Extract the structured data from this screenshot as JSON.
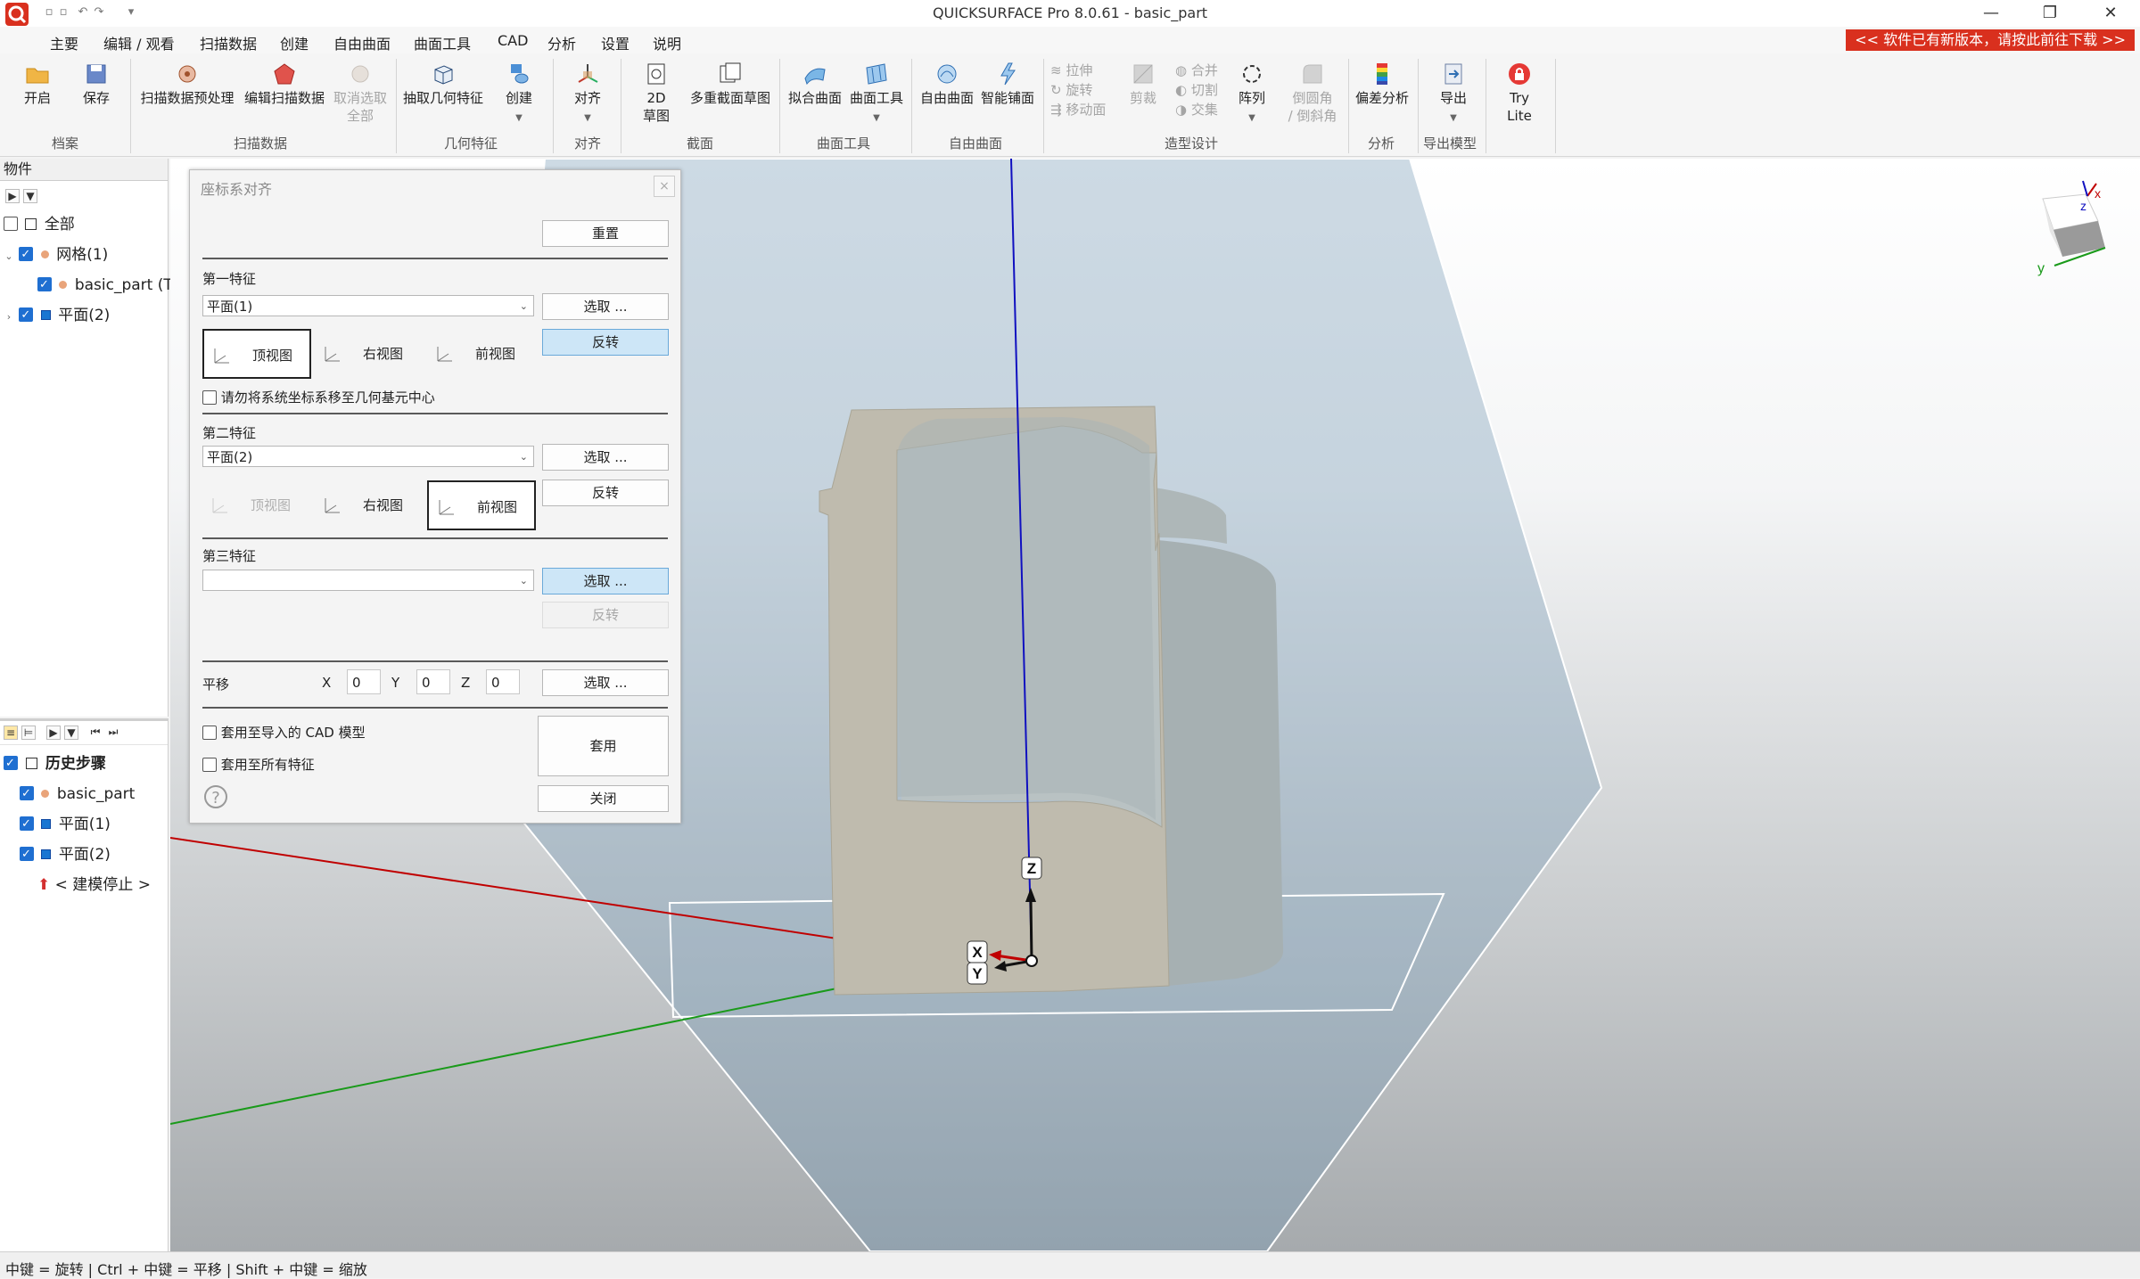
{
  "window": {
    "title": "QUICKSURFACE Pro 8.0.61 - basic_part",
    "minimize": "—",
    "maximize": "❐",
    "close": "✕"
  },
  "menu": {
    "items": [
      "主要",
      "编辑 / 观看",
      "扫描数据",
      "创建",
      "自由曲面",
      "曲面工具",
      "CAD",
      "分析",
      "设置",
      "说明"
    ],
    "active": "主要",
    "update_banner": "<< 软件已有新版本，请按此前往下载 >>"
  },
  "ribbon": {
    "buttons": {
      "open": "开启",
      "save": "保存",
      "scan_preprocess": "扫描数据预处理",
      "edit_scan": "编辑扫描数据",
      "deselect_all": "取消选取全部",
      "extract_features": "抽取几何特征",
      "create": "创建",
      "align": "对齐",
      "sketch2d_line1": "2D",
      "sketch2d_line2": "草图",
      "multi_section": "多重截面草图",
      "fit_surface": "拟合曲面",
      "surface_tools": "曲面工具",
      "freeform": "自由曲面",
      "smart_surface": "智能铺面",
      "extrude": "拉伸",
      "revolve": "旋转",
      "move_face": "移动面",
      "trim": "剪裁",
      "union": "合并",
      "cut": "切割",
      "intersect": "交集",
      "pattern": "阵列",
      "fillet_line1": "倒圆角",
      "fillet_line2": "/ 倒斜角",
      "deviation": "偏差分析",
      "export": "导出",
      "try_lite_line1": "Try",
      "try_lite_line2": "Lite"
    },
    "groups": {
      "file": "档案",
      "scan": "扫描数据",
      "geometry": "几何特征",
      "align": "对齐",
      "section": "截面",
      "surface_tools": "曲面工具",
      "freeform": "自由曲面",
      "modeling": "造型设计",
      "analysis": "分析",
      "export_model": "导出模型"
    }
  },
  "objects_panel": {
    "header": "物件",
    "tree": {
      "all": "全部",
      "mesh": "网格(1)",
      "basic_part": "basic_part (T",
      "plane": "平面(2)"
    }
  },
  "history_panel": {
    "title": "历史步骤",
    "items": [
      "basic_part",
      "平面(1)",
      "平面(2)"
    ],
    "stop": "< 建模停止 >"
  },
  "dialog": {
    "title": "座标系对齐",
    "reset": "重置",
    "feature1": {
      "label": "第一特征",
      "value": "平面(1)",
      "select": "选取 ...",
      "flip": "反转",
      "views": [
        "顶视图",
        "右视图",
        "前视图"
      ],
      "selected_view": "顶视图",
      "no_move_label": "请勿将系统坐标系移至几何基元中心",
      "no_move_checked": false
    },
    "feature2": {
      "label": "第二特征",
      "value": "平面(2)",
      "select": "选取 ...",
      "flip": "反转",
      "views": [
        "顶视图",
        "右视图",
        "前视图"
      ],
      "selected_view": "前视图"
    },
    "feature3": {
      "label": "第三特征",
      "value": "",
      "select": "选取 ...",
      "flip": "反转"
    },
    "translate": {
      "label": "平移",
      "x_label": "X",
      "x": "0",
      "y_label": "Y",
      "y": "0",
      "z_label": "Z",
      "z": "0",
      "select": "选取 ..."
    },
    "apply_cad_label": "套用至导入的 CAD 模型",
    "apply_all_label": "套用至所有特征",
    "apply": "套用",
    "close": "关闭",
    "help": "?"
  },
  "viewport": {
    "axis_x": "X",
    "axis_y": "Y",
    "axis_z": "Z",
    "cube_x": "x",
    "cube_y": "y",
    "cube_z": "z"
  },
  "statusbar": {
    "text": "中键 = 旋转 | Ctrl + 中键 = 平移 | Shift + 中键 = 缩放"
  },
  "colors": {
    "accent": "#1f6fd1",
    "update_banner": "#d9301e",
    "blue_button": "#cde6f7",
    "part_face": "#bdb9ac",
    "part_side": "#a9b1b2",
    "axis_x": "#c00000",
    "axis_y": "#1a9a1a",
    "axis_z": "#1010c0"
  }
}
